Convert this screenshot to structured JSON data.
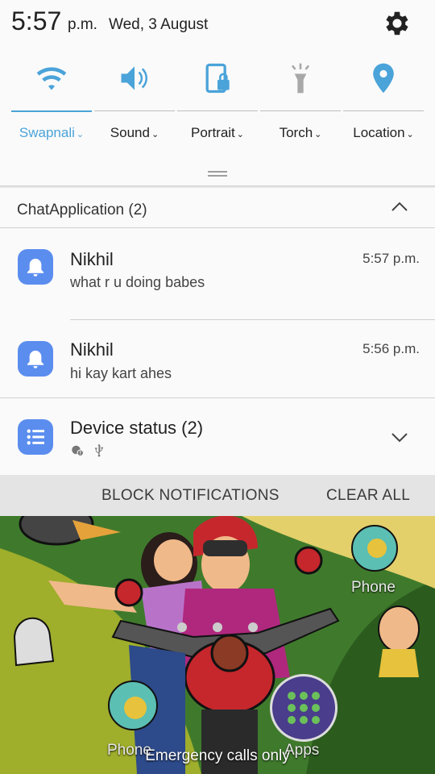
{
  "status": {
    "time": "5:57",
    "ampm": "p.m.",
    "date": "Wed, 3 August",
    "settings_icon": "gear-icon"
  },
  "quick_settings": [
    {
      "label": "Swapnali",
      "icon": "wifi-icon",
      "active": true
    },
    {
      "label": "Sound",
      "icon": "volume-icon",
      "active": false
    },
    {
      "label": "Portrait",
      "icon": "rotation-lock-icon",
      "active": false
    },
    {
      "label": "Torch",
      "icon": "torch-icon",
      "active": false
    },
    {
      "label": "Location",
      "icon": "location-pin-icon",
      "active": true
    }
  ],
  "colors": {
    "accent": "#4aa3d9",
    "app_icon": "#5b8def"
  },
  "notification_group": {
    "title": "ChatApplication (2)",
    "items": [
      {
        "title": "Nikhil",
        "text": "what r u doing babes",
        "time": "5:57 p.m."
      },
      {
        "title": "Nikhil",
        "text": "hi kay kart ahes",
        "time": "5:56 p.m."
      }
    ]
  },
  "device_status": {
    "title": "Device status (2)",
    "icons": [
      "settings-alert-icon",
      "usb-icon"
    ]
  },
  "actions": {
    "block": "BLOCK NOTIFICATIONS",
    "clear": "CLEAR ALL"
  },
  "lockscreen": {
    "phone_label_top": "Phone",
    "phone_label": "Phone",
    "apps_label": "Apps",
    "emergency": "Emergency calls only"
  }
}
